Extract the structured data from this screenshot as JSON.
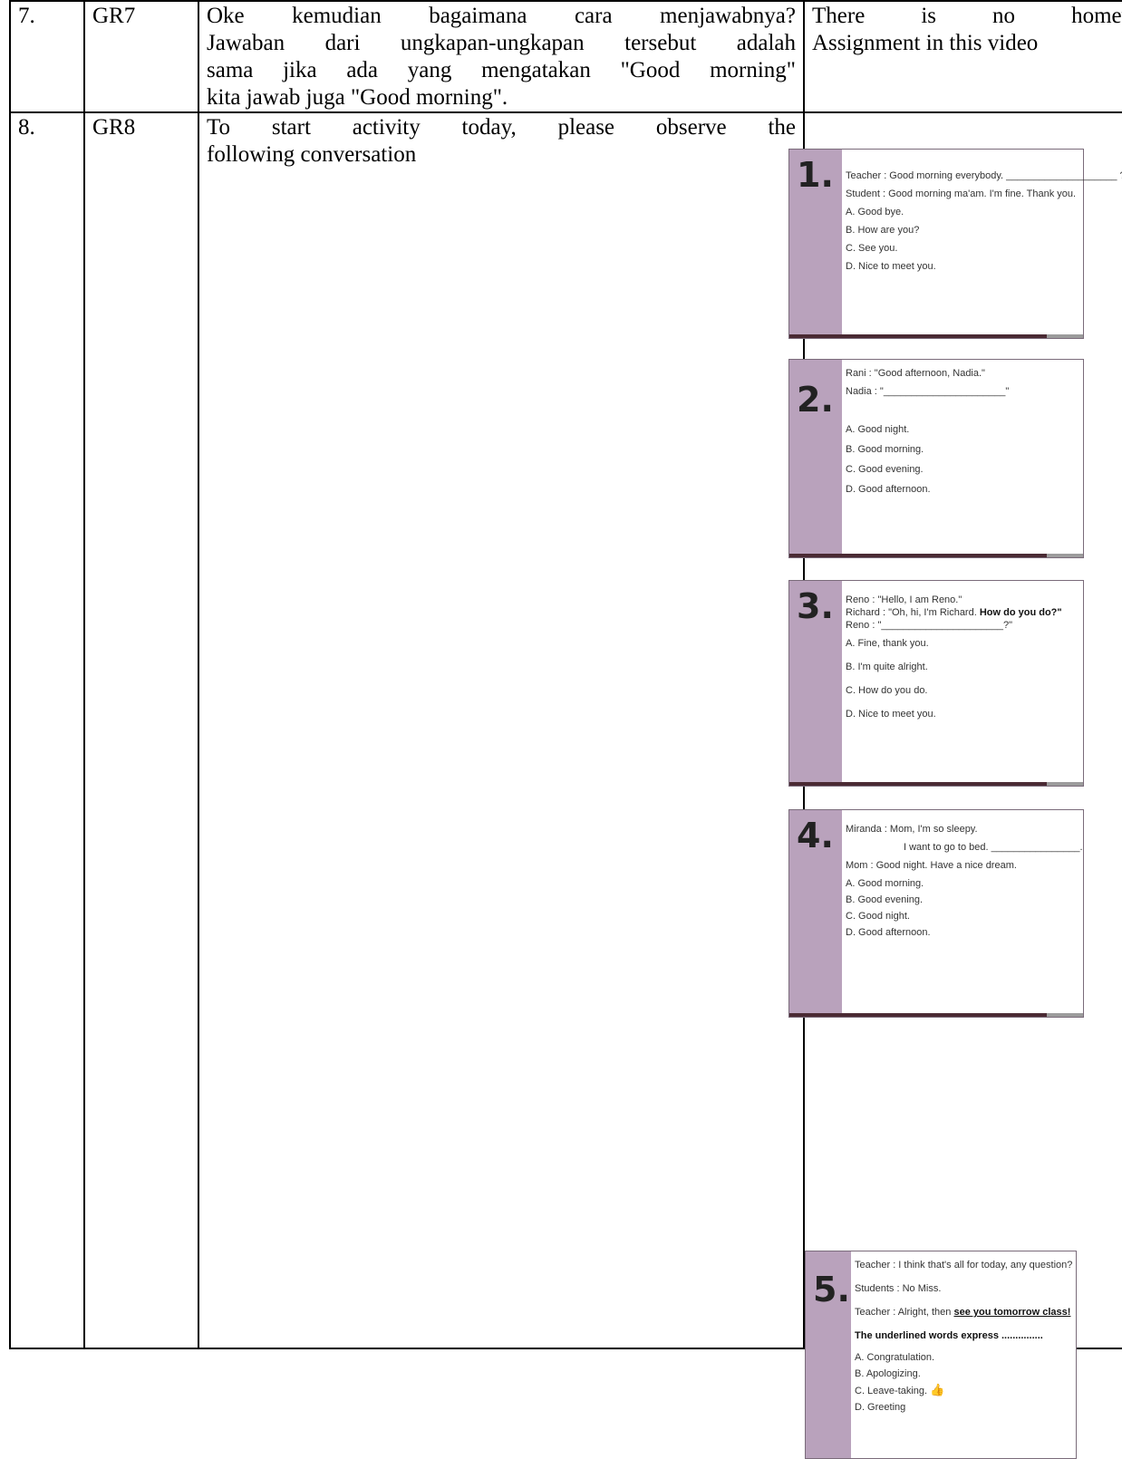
{
  "rows": [
    {
      "number": "7.",
      "code": "GR7",
      "lines": [
        "Oke kemudian bagaimana cara menjawabnya?",
        "Jawaban dari ungkapan-ungkapan tersebut adalah",
        "sama jika ada yang mengatakan \"Good morning\"",
        "kita jawab juga \"Good morning\"."
      ],
      "right_lines": [
        "There is no homework",
        "Assignment in this video"
      ]
    },
    {
      "number": "8.",
      "code": "GR8",
      "lines": [
        "To start activity today, please observe the",
        "following conversation"
      ]
    }
  ],
  "slides": [
    {
      "number": "1.",
      "lines": [
        "Teacher      : Good morning everybody. ____________________ ?",
        "Student      : Good morning ma'am. I'm fine. Thank you."
      ],
      "options": [
        "A.  Good bye.",
        "B.  How are you?",
        "C.  See you.",
        "D.  Nice to meet you."
      ]
    },
    {
      "number": "2.",
      "lines": [
        "Rani  : \"Good afternoon, Nadia.\"",
        "Nadia  : \"______________________\""
      ],
      "options": [
        "A. Good night.",
        "B. Good morning.",
        "C. Good evening.",
        "D. Good afternoon."
      ]
    },
    {
      "number": "3.",
      "lines": [
        "Reno      : \"Hello, I am Reno.\"",
        "Richard   : \"Oh, hi, I'm Richard. ",
        "Reno      : \"______________________?\""
      ],
      "bold_phrase": "How do you do?\"",
      "options": [
        "A.  Fine, thank you.",
        "B.  I'm quite alright.",
        "C.  How do you do.",
        "D.  Nice to meet you."
      ]
    },
    {
      "number": "4.",
      "lines": [
        "Miranda      : Mom, I'm so sleepy.",
        "I want to go to bed. ________________.",
        "Mom          : Good night. Have a nice dream."
      ],
      "options": [
        "A.  Good morning.",
        "B.  Good evening.",
        "C.  Good night.",
        "D.  Good afternoon."
      ]
    },
    {
      "number": "5.",
      "lines": [
        "Teacher      : I think that's all for today, any question?",
        "Students     : No Miss.",
        "Teacher      : Alright, then "
      ],
      "underlined_phrase": "see you tomorrow class!",
      "prompt": "The underlined words express ...............",
      "options": [
        "A.  Congratulation.",
        "B.  Apologizing.",
        "C.  Leave-taking.",
        "D.  Greeting"
      ]
    }
  ]
}
